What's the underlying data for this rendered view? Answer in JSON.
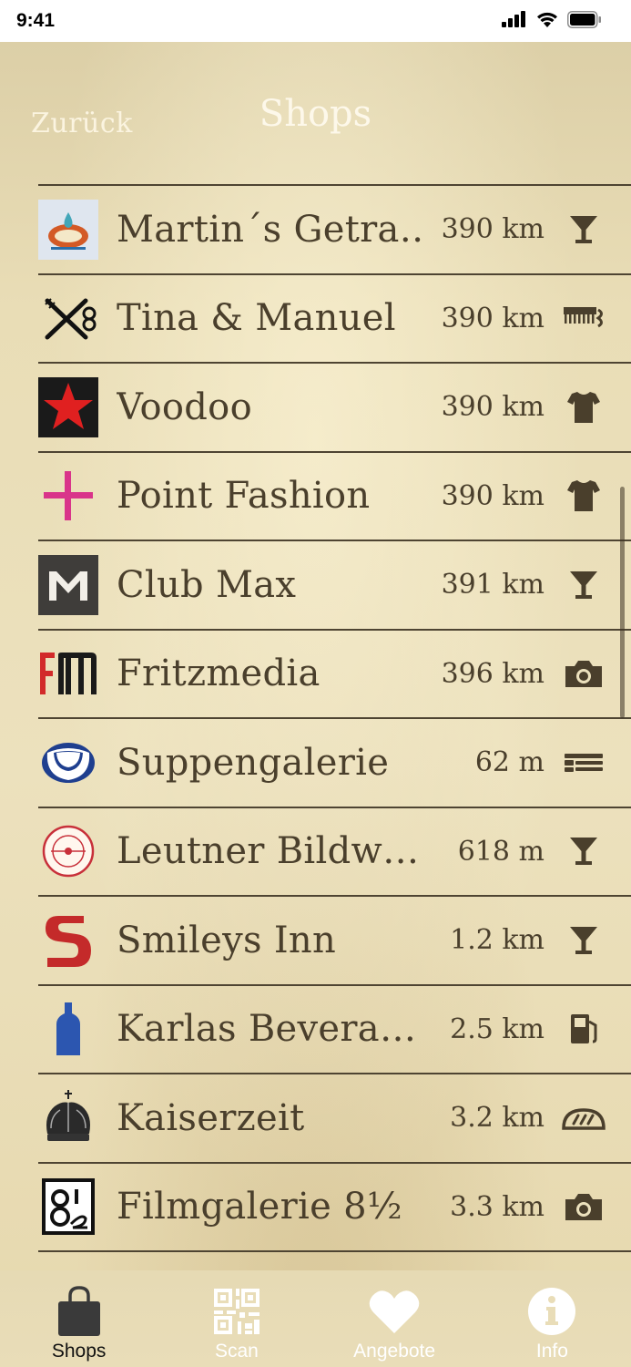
{
  "status_bar": {
    "time": "9:41",
    "icons": [
      "signal-icon",
      "wifi-icon",
      "battery-icon"
    ]
  },
  "nav": {
    "back_label": "Zurück",
    "title": "Shops"
  },
  "colors": {
    "text": "#4a3f2c",
    "divider": "#4e4432",
    "background": "#e9dcb4",
    "nav_text": "#fdf8ea",
    "tab_active": "#111111",
    "tab_inactive": "#ffffff"
  },
  "shops": [
    {
      "name": "Martin´s Getra…",
      "distance": "390 km",
      "logo": "martins-getraenke-logo",
      "category": "cocktail-glass-icon"
    },
    {
      "name": "Tina & Manuel",
      "distance": "390 km",
      "logo": "scissors-comb-logo",
      "category": "comb-icon"
    },
    {
      "name": "Voodoo",
      "distance": "390 km",
      "logo": "red-star-logo",
      "category": "tshirt-icon"
    },
    {
      "name": "Point Fashion",
      "distance": "390 km",
      "logo": "pink-cross-logo",
      "category": "tshirt-icon"
    },
    {
      "name": "Club Max",
      "distance": "391 km",
      "logo": "club-max-logo",
      "category": "cocktail-glass-icon"
    },
    {
      "name": "Fritzmedia",
      "distance": "396 km",
      "logo": "fritzmedia-logo",
      "category": "camera-icon"
    },
    {
      "name": "Suppengalerie",
      "distance": "62 m",
      "logo": "soup-bowl-logo",
      "category": "cutlery-icon"
    },
    {
      "name": "Leutner Bildw…",
      "distance": "618 m",
      "logo": "leutner-seal-logo",
      "category": "cocktail-glass-icon"
    },
    {
      "name": "Smileys Inn",
      "distance": "1.2 km",
      "logo": "smileys-s-logo",
      "category": "cocktail-glass-icon"
    },
    {
      "name": "Karlas Bevera…",
      "distance": "2.5 km",
      "logo": "blue-bottle-logo",
      "category": "fuel-pump-icon"
    },
    {
      "name": "Kaiserzeit",
      "distance": "3.2 km",
      "logo": "crown-logo",
      "category": "bread-icon"
    },
    {
      "name": "Filmgalerie 8½",
      "distance": "3.3 km",
      "logo": "filmgalerie-logo",
      "category": "camera-icon"
    }
  ],
  "tabs": [
    {
      "label": "Shops",
      "icon": "shopping-bag-icon",
      "active": true
    },
    {
      "label": "Scan",
      "icon": "qr-code-icon",
      "active": false
    },
    {
      "label": "Angebote",
      "icon": "heart-icon",
      "active": false
    },
    {
      "label": "Info",
      "icon": "info-icon",
      "active": false
    }
  ]
}
